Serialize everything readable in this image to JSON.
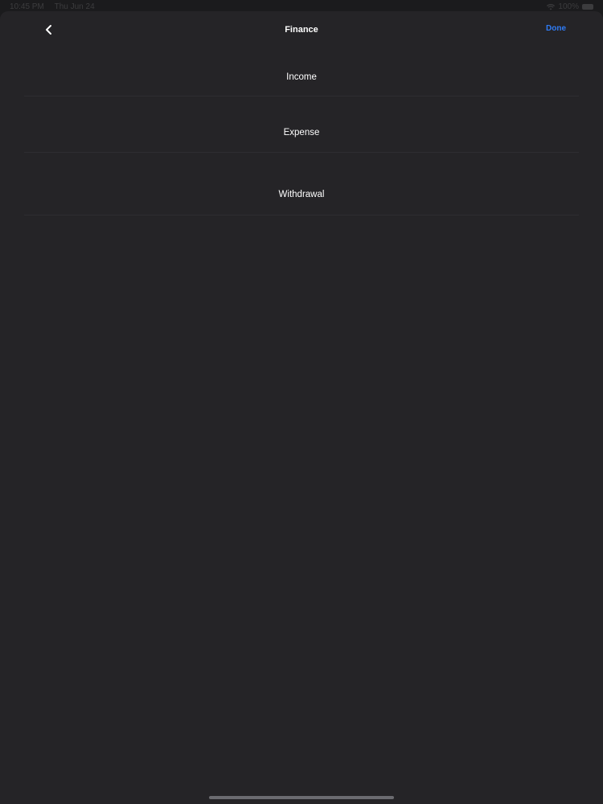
{
  "status_bar": {
    "time": "10:45 PM",
    "date": "Thu Jun 24",
    "battery": "100%",
    "wifi_icon": "wifi-icon",
    "battery_icon": "battery-icon"
  },
  "nav": {
    "title": "Finance",
    "done_label": "Done",
    "back_icon": "chevron-left-icon",
    "accent_color": "#2f7cf6"
  },
  "list": {
    "items": [
      {
        "label": "Income"
      },
      {
        "label": "Expense"
      },
      {
        "label": "Withdrawal"
      }
    ]
  }
}
